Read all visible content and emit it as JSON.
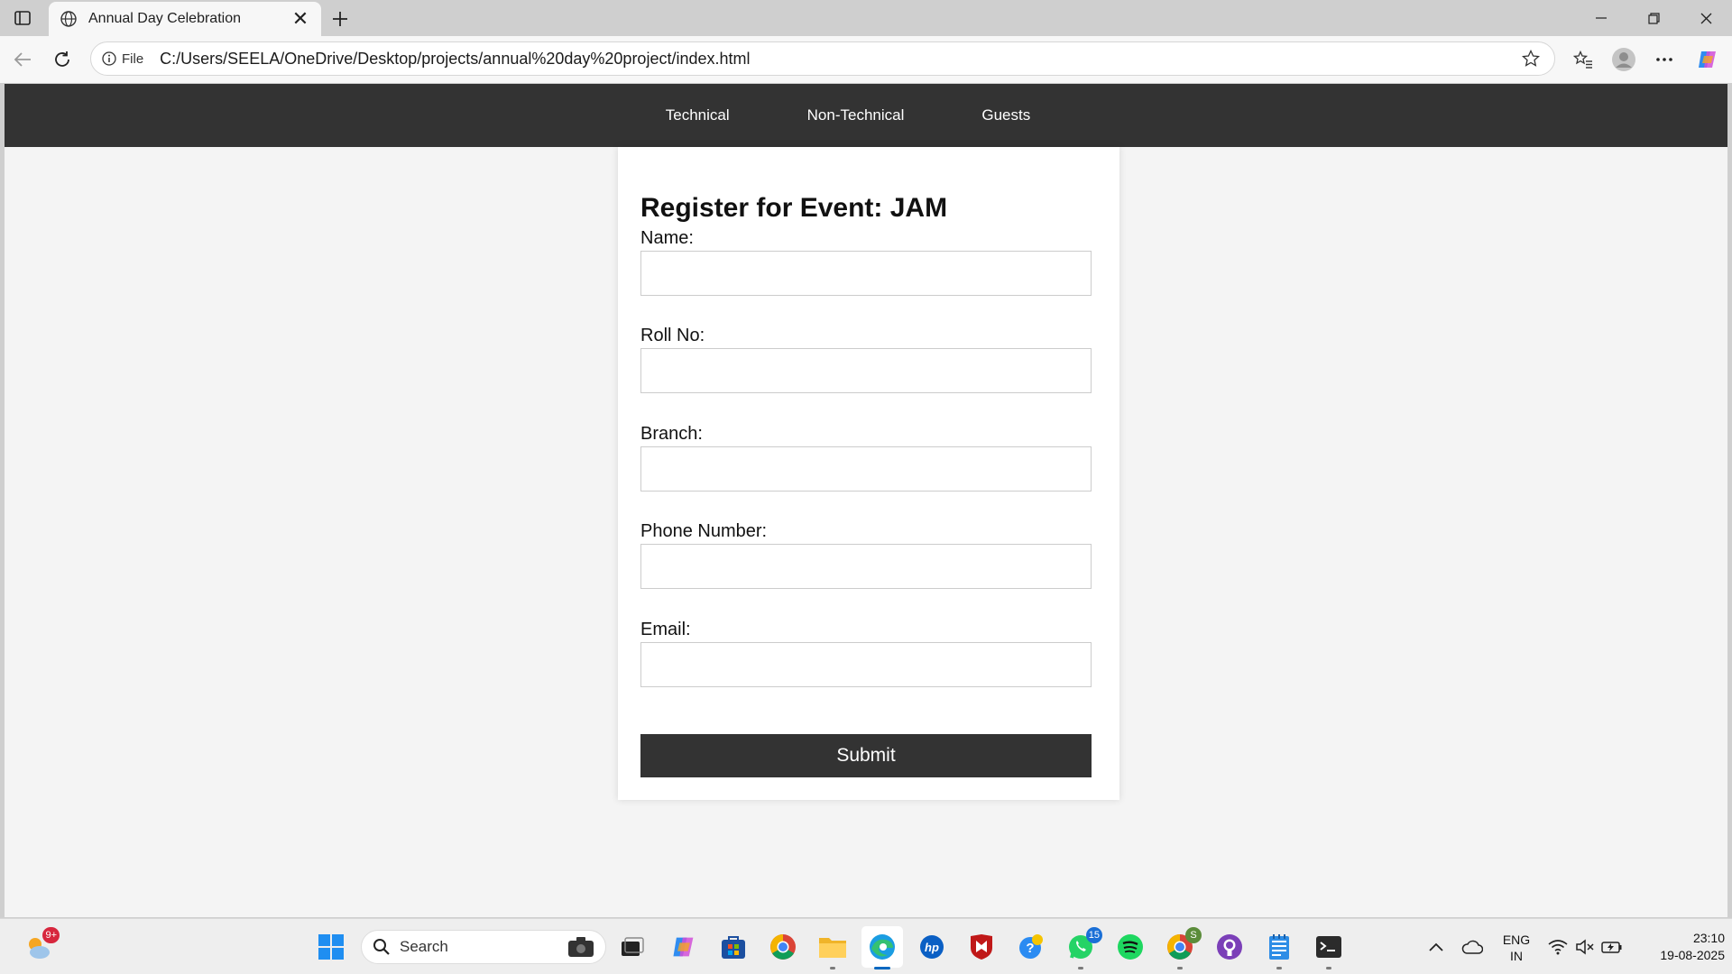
{
  "browser": {
    "tab_title": "Annual Day Celebration",
    "close_glyph": "✕",
    "file_label": "File",
    "url": "C:/Users/SEELA/OneDrive/Desktop/projects/annual%20day%20project/index.html"
  },
  "site": {
    "nav": [
      "Technical",
      "Non-Technical",
      "Guests"
    ],
    "form": {
      "title": "Register for Event: JAM",
      "fields": [
        {
          "label": "Name:",
          "value": ""
        },
        {
          "label": "Roll No:",
          "value": ""
        },
        {
          "label": "Branch:",
          "value": ""
        },
        {
          "label": "Phone Number:",
          "value": ""
        },
        {
          "label": "Email:",
          "value": ""
        }
      ],
      "submit_label": "Submit"
    }
  },
  "taskbar": {
    "weather_badge": "9+",
    "search_placeholder": "Search",
    "whatsapp_badge": "15",
    "chrome_profile_badge": "S",
    "lang_line1": "ENG",
    "lang_line2": "IN",
    "time": "23:10",
    "date": "19-08-2025"
  },
  "colors": {
    "nav_bg": "#333333",
    "page_bg": "#f4f4f4",
    "submit_bg": "#333333",
    "accent": "#0067c0"
  }
}
